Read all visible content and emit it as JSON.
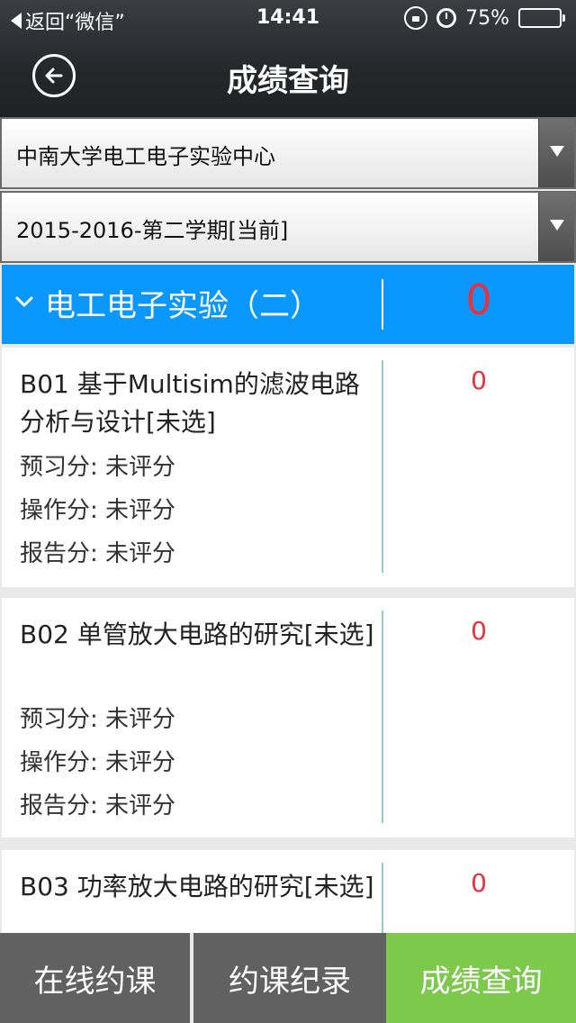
{
  "status_bar": {
    "back_label": "返回“微信”",
    "time": "14:41",
    "battery": "75%",
    "battery_level": 0.75
  },
  "nav": {
    "title": "成绩查询",
    "back_icon": "circle-arrow-left-icon"
  },
  "selects": {
    "center": "中南大学电工电子实验中心",
    "term": "2015-2016-第二学期[当前]"
  },
  "course": {
    "name": "电工电子实验（二）",
    "score": "0"
  },
  "experiments": [
    {
      "title": "B01 基于Multisim的滤波电路分析与设计[未选]",
      "preview": "预习分: 未评分",
      "operation": "操作分: 未评分",
      "report": "报告分: 未评分",
      "score": "0"
    },
    {
      "title": "B02 单管放大电路的研究[未选]",
      "preview": "预习分: 未评分",
      "operation": "操作分: 未评分",
      "report": "报告分: 未评分",
      "score": "0"
    },
    {
      "title": "B03 功率放大电路的研究[未选]",
      "score": "0"
    }
  ],
  "tabs": [
    {
      "label": "在线约课"
    },
    {
      "label": "约课纪录"
    },
    {
      "label": "成绩查询"
    }
  ],
  "colors": {
    "accent_blue": "#0a98ff",
    "score_red": "#e8323e",
    "active_tab_green": "#7cc94b",
    "tab_gray": "#616161"
  }
}
